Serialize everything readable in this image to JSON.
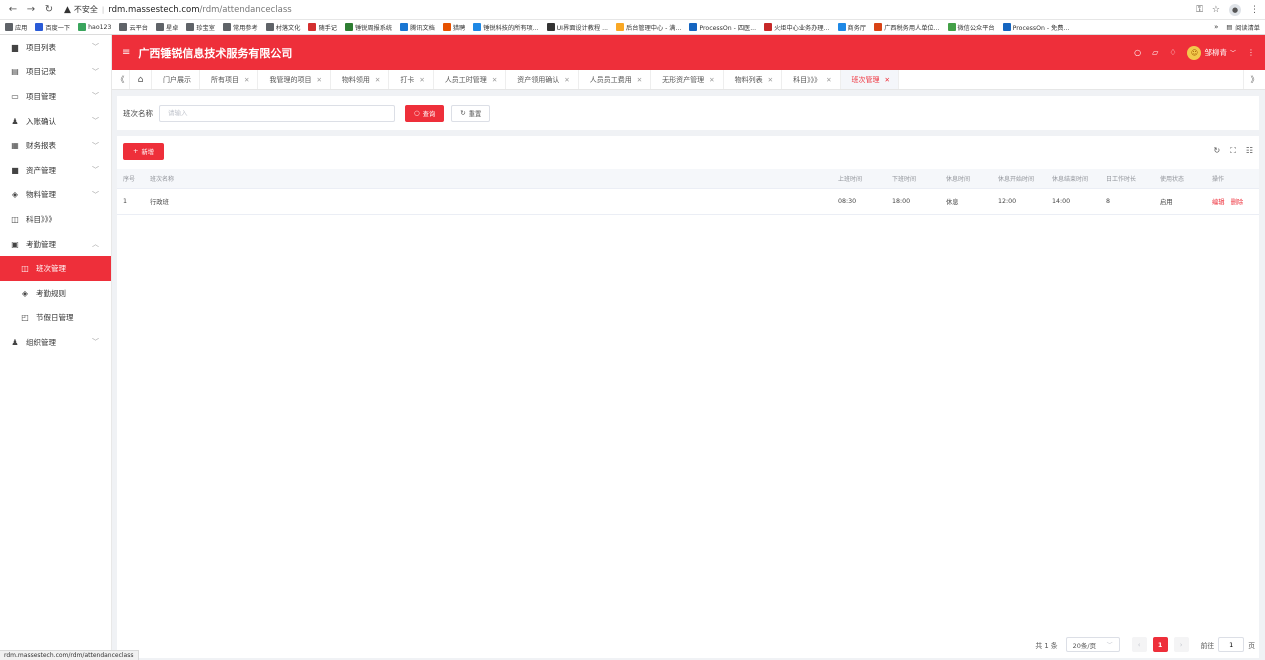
{
  "browser": {
    "insecure_label": "不安全",
    "url_host": "rdm.massestech.com",
    "url_path": "/rdm/attendanceclass",
    "status_url": "rdm.massestech.com/rdm/attendanceclass"
  },
  "bookmarks": [
    {
      "label": "应用",
      "color": "#5f6368"
    },
    {
      "label": "百度一下",
      "color": "#2a5bd7"
    },
    {
      "label": "hao123",
      "color": "#3aa55d"
    },
    {
      "label": "云平台",
      "color": "#5f6368"
    },
    {
      "label": "星卓",
      "color": "#5f6368"
    },
    {
      "label": "珍宝室",
      "color": "#5f6368"
    },
    {
      "label": "常用参考",
      "color": "#5f6368"
    },
    {
      "label": "村落文化",
      "color": "#5f6368"
    },
    {
      "label": "随手记",
      "color": "#d32f2f"
    },
    {
      "label": "锤锐周报系统",
      "color": "#2e7d32"
    },
    {
      "label": "腾讯文档",
      "color": "#1976d2"
    },
    {
      "label": "猎聘",
      "color": "#e65100"
    },
    {
      "label": "锤锐科技的所有项...",
      "color": "#1e88e5"
    },
    {
      "label": "UI界面设计教程 ...",
      "color": "#333333"
    },
    {
      "label": "后台管理中心 - 满...",
      "color": "#f9a825"
    },
    {
      "label": "ProcessOn - 四医...",
      "color": "#1565c0"
    },
    {
      "label": "火炬中心业务办理...",
      "color": "#c62828"
    },
    {
      "label": "商务厅",
      "color": "#1e88e5"
    },
    {
      "label": "广西税务用人单位...",
      "color": "#d84315"
    },
    {
      "label": "微信公众平台",
      "color": "#43a047"
    },
    {
      "label": "ProcessOn - 免费...",
      "color": "#1565c0"
    }
  ],
  "bookmarks_right": {
    "more": "»",
    "reading_list": "阅读清单"
  },
  "app": {
    "title": "广西锤锐信息技术服务有限公司",
    "user_name": "邹柳青",
    "accent": "#ee2f3a"
  },
  "sidebar": {
    "items": [
      {
        "label": "项目列表",
        "icon": "folder-icon",
        "glyph": "▆",
        "chevron": "﹀",
        "sub": false,
        "active": false,
        "name": "sidebar-item-project-list"
      },
      {
        "label": "项目记录",
        "icon": "record-icon",
        "glyph": "▤",
        "chevron": "﹀",
        "sub": false,
        "active": false,
        "name": "sidebar-item-project-record"
      },
      {
        "label": "项目管理",
        "icon": "monitor-icon",
        "glyph": "▭",
        "chevron": "﹀",
        "sub": false,
        "active": false,
        "name": "sidebar-item-project-manage"
      },
      {
        "label": "入账确认",
        "icon": "user-icon",
        "glyph": "♟",
        "chevron": "﹀",
        "sub": false,
        "active": false,
        "name": "sidebar-item-entry-confirm"
      },
      {
        "label": "财务报表",
        "icon": "report-icon",
        "glyph": "▦",
        "chevron": "﹀",
        "sub": false,
        "active": false,
        "name": "sidebar-item-finance-report"
      },
      {
        "label": "资产管理",
        "icon": "briefcase-icon",
        "glyph": "■",
        "chevron": "﹀",
        "sub": false,
        "active": false,
        "name": "sidebar-item-asset-manage"
      },
      {
        "label": "物料管理",
        "icon": "layers-icon",
        "glyph": "◈",
        "chevron": "﹀",
        "sub": false,
        "active": false,
        "name": "sidebar-item-material-manage"
      },
      {
        "label": "科目》》》",
        "icon": "window-icon",
        "glyph": "◫",
        "chevron": "",
        "sub": false,
        "active": false,
        "name": "sidebar-item-subject"
      },
      {
        "label": "考勤管理",
        "icon": "calendar-icon",
        "glyph": "▣",
        "chevron": "︿",
        "sub": false,
        "active": false,
        "name": "sidebar-item-attendance"
      },
      {
        "label": "班次管理",
        "icon": "shift-icon",
        "glyph": "◫",
        "chevron": "",
        "sub": true,
        "active": true,
        "name": "sidebar-item-shift-manage"
      },
      {
        "label": "考勤规则",
        "icon": "rule-icon",
        "glyph": "◈",
        "chevron": "",
        "sub": true,
        "active": false,
        "name": "sidebar-item-attendance-rule"
      },
      {
        "label": "节假日管理",
        "icon": "holiday-icon",
        "glyph": "◰",
        "chevron": "",
        "sub": true,
        "active": false,
        "name": "sidebar-item-holiday-manage"
      },
      {
        "label": "组织管理",
        "icon": "team-icon",
        "glyph": "♟",
        "chevron": "﹀",
        "sub": false,
        "active": false,
        "name": "sidebar-item-org-manage"
      }
    ]
  },
  "tabs": [
    {
      "label": "门户展示",
      "closable": false,
      "active": false
    },
    {
      "label": "所有项目",
      "closable": true,
      "active": false
    },
    {
      "label": "我管理的项目",
      "closable": true,
      "active": false
    },
    {
      "label": "物料领用",
      "closable": true,
      "active": false
    },
    {
      "label": "打卡",
      "closable": true,
      "active": false
    },
    {
      "label": "人员工时管理",
      "closable": true,
      "active": false
    },
    {
      "label": "资产领用确认",
      "closable": true,
      "active": false
    },
    {
      "label": "人员员工费用",
      "closable": true,
      "active": false
    },
    {
      "label": "无形资产管理",
      "closable": true,
      "active": false
    },
    {
      "label": "物料列表",
      "closable": true,
      "active": false
    },
    {
      "label": "科目》》》",
      "closable": true,
      "active": false
    },
    {
      "label": "班次管理",
      "closable": true,
      "active": true
    }
  ],
  "search": {
    "label": "班次名称",
    "placeholder": "请输入",
    "value": "",
    "query_label": "查询",
    "reset_label": "重置"
  },
  "toolbar": {
    "add_label": "新增"
  },
  "table": {
    "columns": [
      "序号",
      "班次名称",
      "上班时间",
      "下班时间",
      "休息时间",
      "休息开始时间",
      "休息结束时间",
      "日工作时长",
      "使用状态",
      "操作"
    ],
    "rows": [
      {
        "index": "1",
        "name": "行政班",
        "start": "08:30",
        "end": "18:00",
        "rest": "休息",
        "rest_start": "12:00",
        "rest_end": "14:00",
        "hours": "8",
        "status": "启用",
        "edit": "编辑",
        "delete": "删除"
      }
    ]
  },
  "pager": {
    "total": "共 1 条",
    "page_size": "20条/页",
    "current_page": "1",
    "goto_label": "前往",
    "goto_value": "1",
    "page_unit": "页"
  }
}
